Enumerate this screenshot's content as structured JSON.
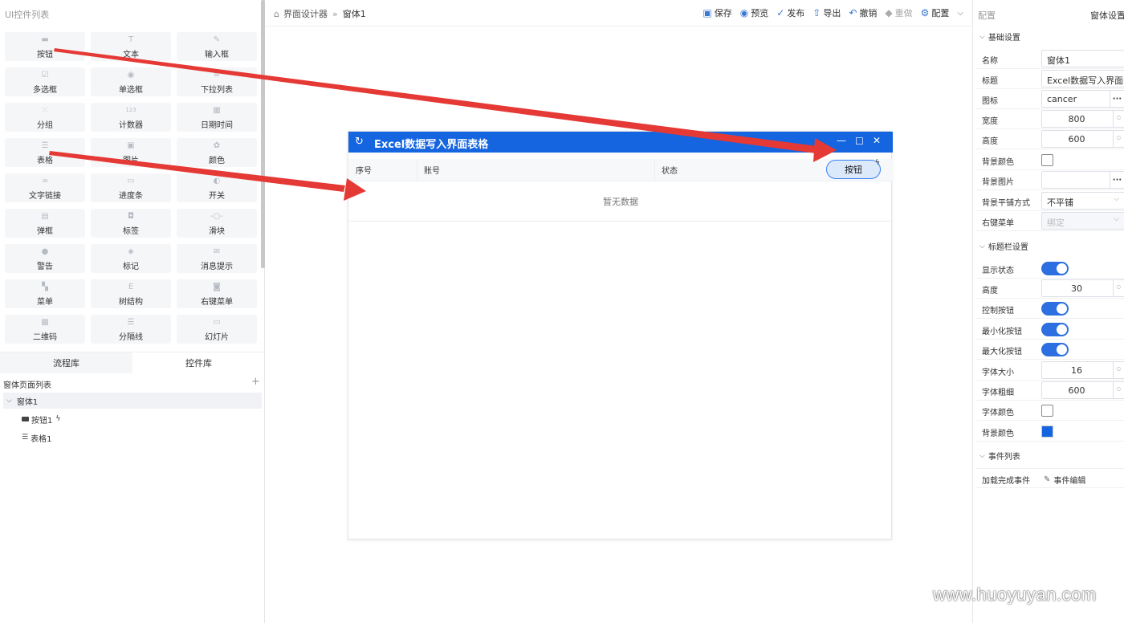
{
  "left_panel": {
    "title": "UI控件列表",
    "widgets": [
      {
        "label": "按钮",
        "icon": "button-icon"
      },
      {
        "label": "文本",
        "icon": "text-icon"
      },
      {
        "label": "输入框",
        "icon": "pen-icon"
      },
      {
        "label": "多选框",
        "icon": "checkbox-icon"
      },
      {
        "label": "单选框",
        "icon": "radio-icon"
      },
      {
        "label": "下拉列表",
        "icon": "list-sort-icon"
      },
      {
        "label": "分组",
        "icon": "dot-grid-icon"
      },
      {
        "label": "计数器",
        "icon": "counter-123-icon"
      },
      {
        "label": "日期时间",
        "icon": "calendar-icon"
      },
      {
        "label": "表格",
        "icon": "list-icon"
      },
      {
        "label": "图片",
        "icon": "image-icon"
      },
      {
        "label": "颜色",
        "icon": "palette-icon"
      },
      {
        "label": "文字链接",
        "icon": "link-icon"
      },
      {
        "label": "进度条",
        "icon": "progress-icon"
      },
      {
        "label": "开关",
        "icon": "toggle-icon"
      },
      {
        "label": "弹框",
        "icon": "message-icon"
      },
      {
        "label": "标签",
        "icon": "bookmark-icon"
      },
      {
        "label": "滑块",
        "icon": "slider-icon"
      },
      {
        "label": "警告",
        "icon": "warning-icon"
      },
      {
        "label": "标记",
        "icon": "tag-icon"
      },
      {
        "label": "消息提示",
        "icon": "mail-icon"
      },
      {
        "label": "菜单",
        "icon": "menu-grid-icon"
      },
      {
        "label": "树结构",
        "icon": "tree-icon"
      },
      {
        "label": "右键菜单",
        "icon": "mouse-icon"
      },
      {
        "label": "二维码",
        "icon": "qrcode-icon"
      },
      {
        "label": "分隔线",
        "icon": "divider-icon"
      },
      {
        "label": "幻灯片",
        "icon": "slides-icon"
      }
    ],
    "tabs": [
      "流程库",
      "控件库"
    ],
    "page_list_title": "窗体页面列表",
    "tree": {
      "root": "窗体1",
      "children": [
        {
          "label": "按钮1",
          "icon": "button-icon",
          "has_event": true
        },
        {
          "label": "表格1",
          "icon": "list-icon",
          "has_event": false
        }
      ]
    }
  },
  "topbar": {
    "breadcrumb": [
      "界面设计器",
      "窗体1"
    ],
    "tools": [
      {
        "label": "保存",
        "icon": "save-icon"
      },
      {
        "label": "预览",
        "icon": "eye-icon"
      },
      {
        "label": "发布",
        "icon": "publish-icon"
      },
      {
        "label": "导出",
        "icon": "export-icon"
      },
      {
        "label": "撤销",
        "icon": "undo-icon"
      },
      {
        "label": "重做",
        "icon": "eraser-icon",
        "disabled": true
      },
      {
        "label": "配置",
        "icon": "gear-icon"
      }
    ]
  },
  "form": {
    "title": "Excel数据写入界面表格",
    "title_icon": "refresh-icon",
    "columns": [
      "序号",
      "账号",
      "状态"
    ],
    "empty_text": "暂无数据",
    "button_label": "按钮",
    "title_bg": "#1565e0"
  },
  "right_panel": {
    "header_left": "配置",
    "header_right": "窗体设置",
    "sections": {
      "basic": "基础设置",
      "titlebar": "标题栏设置",
      "events": "事件列表"
    },
    "basic": {
      "name_label": "名称",
      "name_value": "窗体1",
      "title_label": "标题",
      "title_value": "Excel数据写入界面表格",
      "icon_label": "图标",
      "icon_value": "cancer",
      "width_label": "宽度",
      "width_value": "800",
      "height_label": "高度",
      "height_value": "600",
      "bgcolor_label": "背景颜色",
      "bgimage_label": "背景图片",
      "tile_label": "背景平铺方式",
      "tile_value": "不平铺",
      "ctxmenu_label": "右键菜单",
      "ctxmenu_placeholder": "绑定"
    },
    "titlebar": {
      "show_label": "显示状态",
      "show_on": true,
      "height_label": "高度",
      "height_value": "30",
      "ctrl_label": "控制按钮",
      "ctrl_on": true,
      "min_label": "最小化按钮",
      "min_on": true,
      "max_label": "最大化按钮",
      "max_on": true,
      "fontsize_label": "字体大小",
      "fontsize_value": "16",
      "fontweight_label": "字体粗细",
      "fontweight_value": "600",
      "fontcolor_label": "字体颜色",
      "bgcolor_label": "背景颜色",
      "bgcolor_value": "#1565e0"
    },
    "events": {
      "load_label": "加载完成事件",
      "edit_label": "事件编辑"
    }
  },
  "colors": {
    "accent": "#1565e0",
    "switch_on": "#2d6fe0",
    "arrow": "#e53935"
  },
  "watermark": "www.huoyuyan.com"
}
